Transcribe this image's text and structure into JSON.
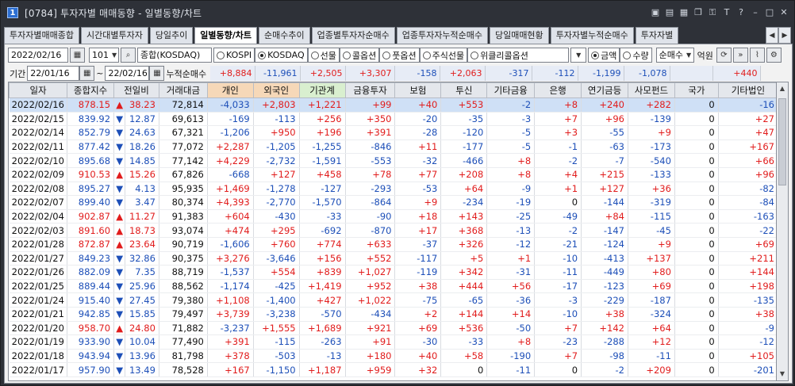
{
  "window": {
    "number": "1",
    "title": "[0784] 투자자별 매매동향 - 일별동향/차트"
  },
  "tabs": [
    "투자자별매매종합",
    "시간대별투자자",
    "당일추이",
    "일별동향/차트",
    "순매수추이",
    "업종별투자자순매수",
    "업종투자자누적순매수",
    "당일매매현황",
    "투자자별누적순매수",
    "투자자별"
  ],
  "active_tab": 3,
  "toolbar": {
    "date": "2022/02/16",
    "code": "101",
    "market_name": "종합(KOSDAQ)",
    "radios": [
      "KOSPI",
      "KOSDAQ",
      "선물",
      "콜옵션",
      "풋옵션",
      "주식선물",
      "위클리콜옵션"
    ],
    "radio_selected": "KOSDAQ",
    "amount_radios": [
      "금액",
      "수량"
    ],
    "amount_selected": "금액",
    "mode": "순매수",
    "unit": "억원"
  },
  "period": {
    "label": "기간",
    "from": "22/01/16",
    "to": "22/02/16",
    "cum_label": "누적순매수",
    "cum_values": [
      "+8,884",
      "-11,961",
      "+2,505",
      "+3,307",
      "-158",
      "+2,063",
      "-317",
      "-112",
      "-1,199",
      "-1,078",
      "",
      "+440"
    ]
  },
  "columns": [
    "일자",
    "종합지수",
    "전일비",
    "거래대금",
    "개인",
    "외국인",
    "기관계",
    "금융투자",
    "보험",
    "투신",
    "기타금융",
    "은행",
    "연기금등",
    "사모펀드",
    "국가",
    "기타법인"
  ],
  "rows": [
    [
      "2022/02/16",
      "878.15",
      "▲",
      "38.23",
      "72,814",
      "-4,033",
      "+2,803",
      "+1,221",
      "+99",
      "+40",
      "+553",
      "-2",
      "+8",
      "+240",
      "+282",
      "0",
      "-16"
    ],
    [
      "2022/02/15",
      "839.92",
      "▼",
      "12.87",
      "69,613",
      "-169",
      "-113",
      "+256",
      "+350",
      "-20",
      "-35",
      "-3",
      "+7",
      "+96",
      "-139",
      "0",
      "+27"
    ],
    [
      "2022/02/14",
      "852.79",
      "▼",
      "24.63",
      "67,321",
      "-1,206",
      "+950",
      "+196",
      "+391",
      "-28",
      "-120",
      "-5",
      "+3",
      "-55",
      "+9",
      "0",
      "+47"
    ],
    [
      "2022/02/11",
      "877.42",
      "▼",
      "18.26",
      "77,072",
      "+2,287",
      "-1,205",
      "-1,255",
      "-846",
      "+11",
      "-177",
      "-5",
      "-1",
      "-63",
      "-173",
      "0",
      "+167"
    ],
    [
      "2022/02/10",
      "895.68",
      "▼",
      "14.85",
      "77,142",
      "+4,229",
      "-2,732",
      "-1,591",
      "-553",
      "-32",
      "-466",
      "+8",
      "-2",
      "-7",
      "-540",
      "0",
      "+66"
    ],
    [
      "2022/02/09",
      "910.53",
      "▲",
      "15.26",
      "67,826",
      "-668",
      "+127",
      "+458",
      "+78",
      "+77",
      "+208",
      "+8",
      "+4",
      "+215",
      "-133",
      "0",
      "+96"
    ],
    [
      "2022/02/08",
      "895.27",
      "▼",
      "4.13",
      "95,935",
      "+1,469",
      "-1,278",
      "-127",
      "-293",
      "-53",
      "+64",
      "-9",
      "+1",
      "+127",
      "+36",
      "0",
      "-82"
    ],
    [
      "2022/02/07",
      "899.40",
      "▼",
      "3.47",
      "80,374",
      "+4,393",
      "-2,770",
      "-1,570",
      "-864",
      "+9",
      "-234",
      "-19",
      "0",
      "-144",
      "-319",
      "0",
      "-84"
    ],
    [
      "2022/02/04",
      "902.87",
      "▲",
      "11.27",
      "91,383",
      "+604",
      "-430",
      "-33",
      "-90",
      "+18",
      "+143",
      "-25",
      "-49",
      "+84",
      "-115",
      "0",
      "-163"
    ],
    [
      "2022/02/03",
      "891.60",
      "▲",
      "18.73",
      "93,074",
      "+474",
      "+295",
      "-692",
      "-870",
      "+17",
      "+368",
      "-13",
      "-2",
      "-147",
      "-45",
      "0",
      "-22"
    ],
    [
      "2022/01/28",
      "872.87",
      "▲",
      "23.64",
      "90,719",
      "-1,606",
      "+760",
      "+774",
      "+633",
      "-37",
      "+326",
      "-12",
      "-21",
      "-124",
      "+9",
      "0",
      "+69"
    ],
    [
      "2022/01/27",
      "849.23",
      "▼",
      "32.86",
      "90,375",
      "+3,276",
      "-3,646",
      "+156",
      "+552",
      "-117",
      "+5",
      "+1",
      "-10",
      "-413",
      "+137",
      "0",
      "+211"
    ],
    [
      "2022/01/26",
      "882.09",
      "▼",
      "7.35",
      "88,719",
      "-1,537",
      "+554",
      "+839",
      "+1,027",
      "-119",
      "+342",
      "-31",
      "-11",
      "-449",
      "+80",
      "0",
      "+144"
    ],
    [
      "2022/01/25",
      "889.44",
      "▼",
      "25.96",
      "88,562",
      "-1,174",
      "-425",
      "+1,419",
      "+952",
      "+38",
      "+444",
      "+56",
      "-17",
      "-123",
      "+69",
      "0",
      "+198"
    ],
    [
      "2022/01/24",
      "915.40",
      "▼",
      "27.45",
      "79,380",
      "+1,108",
      "-1,400",
      "+427",
      "+1,022",
      "-75",
      "-65",
      "-36",
      "-3",
      "-229",
      "-187",
      "0",
      "-135"
    ],
    [
      "2022/01/21",
      "942.85",
      "▼",
      "15.85",
      "79,497",
      "+3,739",
      "-3,238",
      "-570",
      "-434",
      "+2",
      "+144",
      "+14",
      "-10",
      "+38",
      "-324",
      "0",
      "+38"
    ],
    [
      "2022/01/20",
      "958.70",
      "▲",
      "24.80",
      "71,882",
      "-3,237",
      "+1,555",
      "+1,689",
      "+921",
      "+69",
      "+536",
      "-50",
      "+7",
      "+142",
      "+64",
      "0",
      "-9"
    ],
    [
      "2022/01/19",
      "933.90",
      "▼",
      "10.04",
      "77,490",
      "+391",
      "-115",
      "-263",
      "+91",
      "-30",
      "-33",
      "+8",
      "-23",
      "-288",
      "+12",
      "0",
      "-12"
    ],
    [
      "2022/01/18",
      "943.94",
      "▼",
      "13.96",
      "81,798",
      "+378",
      "-503",
      "-13",
      "+180",
      "+40",
      "+58",
      "-190",
      "+7",
      "-98",
      "-11",
      "0",
      "+105"
    ],
    [
      "2022/01/17",
      "957.90",
      "▼",
      "13.49",
      "78,528",
      "+167",
      "-1,150",
      "+1,187",
      "+959",
      "+32",
      "0",
      "-11",
      "0",
      "-2",
      "+209",
      "0",
      "-201"
    ]
  ],
  "colors": {
    "up": "#e11c1c",
    "down": "#1d4fb8",
    "selected_row": "#cfe0f6"
  }
}
